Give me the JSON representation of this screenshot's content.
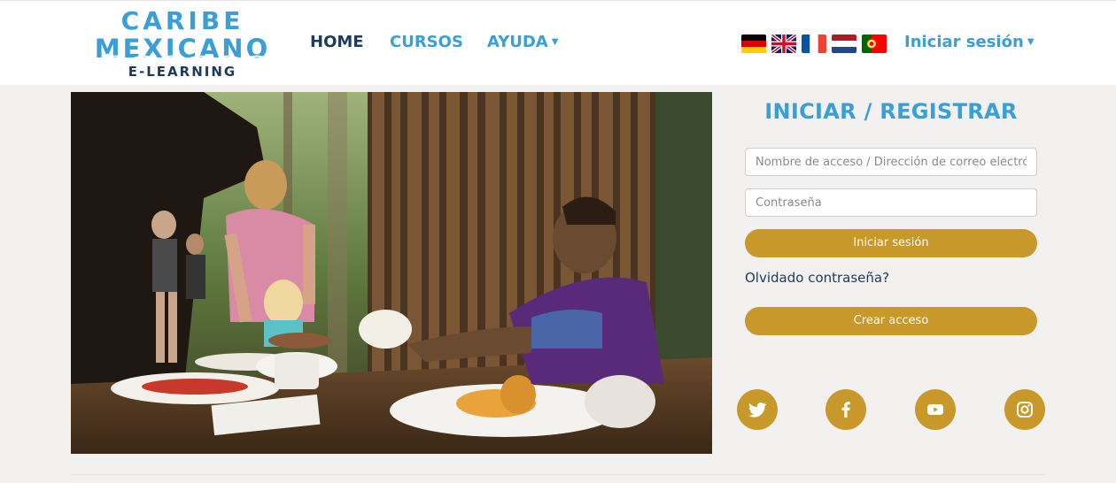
{
  "brand": {
    "line1": "CARIBE",
    "line2": "MEXICANO",
    "line3": "E-LEARNING"
  },
  "nav": {
    "home": "HOME",
    "courses": "CURSOS",
    "help": "AYUDA"
  },
  "languages": [
    "Deutsch",
    "English",
    "Français",
    "Nederlands",
    "Português"
  ],
  "user_menu": {
    "login_label": "Iniciar sesión"
  },
  "login_panel": {
    "title": "INICIAR / REGISTRAR",
    "username_placeholder": "Nombre de acceso / Dirección de correo electrónico",
    "password_placeholder": "Contraseña",
    "login_button": "Iniciar sesión",
    "forgot_link": "Olvidado contraseña?",
    "create_account_button": "Crear acceso"
  },
  "social": [
    "twitter-icon",
    "facebook-icon",
    "youtube-icon",
    "instagram-icon"
  ],
  "colors": {
    "brand_blue": "#3a9fd6",
    "navy": "#1f3a5a",
    "gold": "#c9982a",
    "background": "#f2f1ef"
  }
}
